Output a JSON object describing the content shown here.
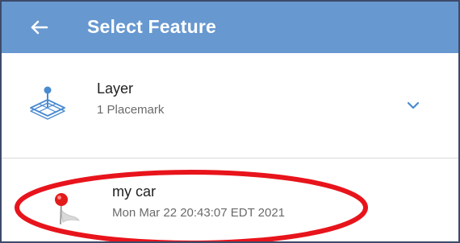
{
  "appbar": {
    "title": "Select Feature",
    "back_icon": "arrow-left-icon",
    "background_color": "#6798d0"
  },
  "layer": {
    "name": "Layer",
    "subtitle": "1 Placemark",
    "icon": "layer-pushpin-icon",
    "expand_icon": "chevron-down-icon"
  },
  "feature": {
    "name": "my car",
    "timestamp": "Mon Mar 22 20:43:07 EDT 2021",
    "icon": "red-pushpin-icon"
  },
  "annotation": {
    "type": "red-ellipse-highlight",
    "color": "#e8141c"
  },
  "colors": {
    "accent": "#4a8ad0",
    "primary_text": "#1f1f1f",
    "secondary_text": "#6a6a6a"
  }
}
